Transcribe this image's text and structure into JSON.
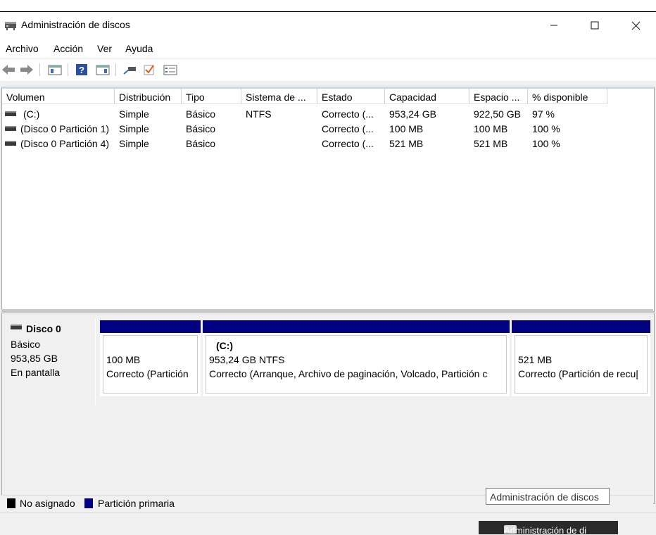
{
  "window": {
    "title": "Administración de discos"
  },
  "menu": [
    "Archivo",
    "Acción",
    "Ver",
    "Ayuda"
  ],
  "toolbar_icons": [
    "back-icon",
    "forward-icon",
    "properties-icon",
    "help-icon",
    "show-pane-icon",
    "connect-icon",
    "check-icon",
    "list-icon"
  ],
  "volumes": {
    "columns": [
      "Volumen",
      "Distribución",
      "Tipo",
      "Sistema de ...",
      "Estado",
      "Capacidad",
      "Espacio ...",
      "% disponible"
    ],
    "rows": [
      [
        "(C:)",
        "Simple",
        "Básico",
        "NTFS",
        "Correcto (...",
        "953,24 GB",
        "922,50 GB",
        "97 %"
      ],
      [
        "(Disco 0 Partición 1)",
        "Simple",
        "Básico",
        "",
        "Correcto (...",
        "100 MB",
        "100 MB",
        "100 %"
      ],
      [
        "(Disco 0 Partición 4)",
        "Simple",
        "Básico",
        "",
        "Correcto (...",
        "521 MB",
        "521 MB",
        "100 %"
      ]
    ]
  },
  "disk": {
    "name": "Disco 0",
    "type": "Básico",
    "size": "953,85 GB",
    "status": "En pantalla",
    "partitions": [
      {
        "label": "",
        "size": "100 MB",
        "status": "Correcto (Partición"
      },
      {
        "label": "(C:)",
        "size": "953,24 GB NTFS",
        "status": "Correcto (Arranque, Archivo de paginación, Volcado, Partición c"
      },
      {
        "label": "",
        "size": "521 MB",
        "status": "Correcto (Partición de recu|"
      }
    ]
  },
  "legend": [
    {
      "label": "No asignado",
      "color": "#000000"
    },
    {
      "label": "Partición primaria",
      "color": "#000080"
    }
  ],
  "tooltip": "Administración de discos",
  "taskbar_preview": "Administración de di"
}
